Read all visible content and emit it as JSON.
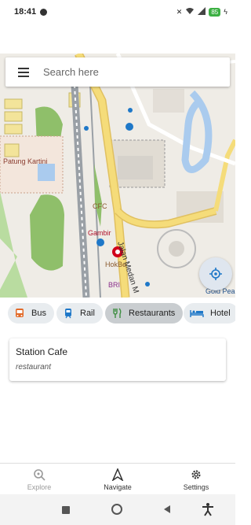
{
  "status_bar": {
    "time": "18:41",
    "battery": "85"
  },
  "search": {
    "placeholder": "Search here"
  },
  "map": {
    "labels": {
      "patung_kartini": "Patung Kartini",
      "cfc": "CFC",
      "gambir": "Gambir",
      "hokben": "HokBe",
      "bri": "BRI",
      "street": "Jalan Medan M",
      "gold_peak": "Gold Pea"
    }
  },
  "categories": [
    {
      "label": "Bus",
      "icon": "bus-icon"
    },
    {
      "label": "Rail",
      "icon": "rail-icon"
    },
    {
      "label": "Restaurants",
      "icon": "restaurant-icon",
      "active": true
    },
    {
      "label": "Hotel",
      "icon": "hotel-icon"
    }
  ],
  "results": [
    {
      "name": "Station Cafe",
      "type": "restaurant"
    }
  ],
  "bottom_nav": {
    "explore": "Explore",
    "navigate": "Navigate",
    "settings": "Settings"
  },
  "colors": {
    "accent": "#1f78c8",
    "chip_bg": "#e8ecef",
    "chip_active_bg": "#c9cdd0",
    "map_road_yellow": "#f5dc7a",
    "map_water": "#aacbee",
    "map_park": "#8fbf6a"
  }
}
